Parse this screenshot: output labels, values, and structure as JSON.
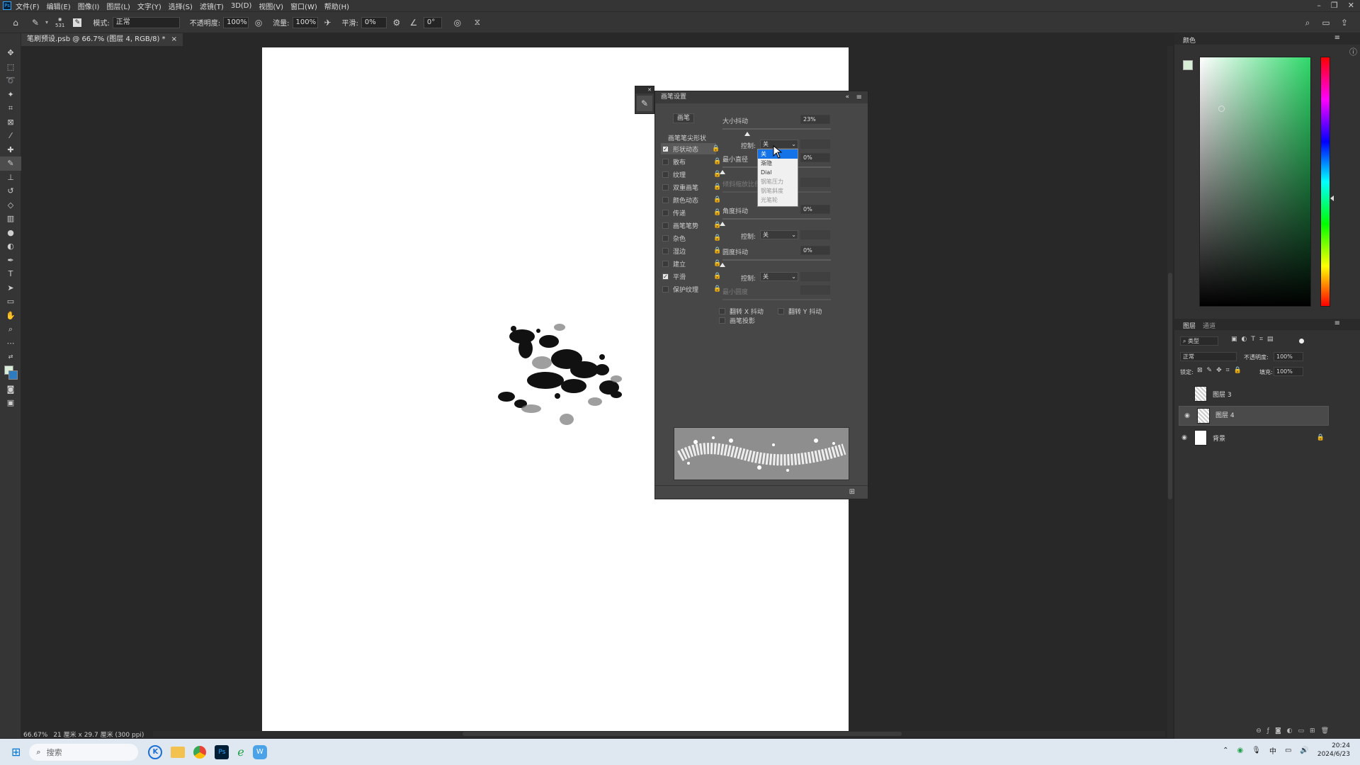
{
  "menu": {
    "items": [
      "文件(F)",
      "编辑(E)",
      "图像(I)",
      "图层(L)",
      "文字(Y)",
      "选择(S)",
      "滤镜(T)",
      "3D(D)",
      "视图(V)",
      "窗口(W)",
      "帮助(H)"
    ]
  },
  "options": {
    "brush_size": "531",
    "mode_label": "模式:",
    "mode_value": "正常",
    "opacity_label": "不透明度:",
    "opacity_value": "100%",
    "flow_label": "流量:",
    "flow_value": "100%",
    "smooth_label": "平滑:",
    "smooth_value": "0%",
    "angle_value": "0°"
  },
  "document": {
    "tab_title": "笔刷预设.psb @ 66.7% (图层 4, RGB/8) *",
    "close_glyph": "×"
  },
  "status": {
    "zoom": "66.67%",
    "size_info": "21 厘米 x 29.7 厘米 (300 ppi)"
  },
  "brush_panel": {
    "title": "画笔设置",
    "brushes_button": "画笔",
    "tip_shape": "画笔笔尖形状",
    "options": [
      {
        "label": "形状动态",
        "checked": true
      },
      {
        "label": "散布",
        "checked": false
      },
      {
        "label": "纹理",
        "checked": false
      },
      {
        "label": "双重画笔",
        "checked": false
      },
      {
        "label": "颜色动态",
        "checked": false
      },
      {
        "label": "传递",
        "checked": false
      },
      {
        "label": "画笔笔势",
        "checked": false
      },
      {
        "label": "杂色",
        "checked": false
      },
      {
        "label": "湿边",
        "checked": false
      },
      {
        "label": "建立",
        "checked": false
      },
      {
        "label": "平滑",
        "checked": true
      },
      {
        "label": "保护纹理",
        "checked": false
      }
    ],
    "size_jitter_label": "大小抖动",
    "size_jitter_value": "23%",
    "control_label": "控制:",
    "control_value": "关",
    "min_diameter_label": "最小直径",
    "min_diameter_value": "0%",
    "tilt_scale_label": "倾斜缩放比例",
    "angle_jitter_label": "角度抖动",
    "angle_jitter_value": "0%",
    "roundness_jitter_label": "圆度抖动",
    "roundness_jitter_value": "0%",
    "min_roundness_label": "最小圆度",
    "flip_x": "翻转 X 抖动",
    "flip_y": "翻转 Y 抖动",
    "brush_projection": "画笔投影",
    "size_jitter_level": 0.23,
    "dropdown": [
      "关",
      "渐隐",
      "Dial",
      "钢笔压力",
      "钢笔斜度",
      "光笔轮"
    ]
  },
  "right_panel": {
    "color_tab": "颜色",
    "layers_tab": "图层",
    "channels_tab": "通道",
    "kind_label": "类型",
    "blend_mode": "正常",
    "opacity_label": "不透明度:",
    "opacity_value": "100%",
    "lock_label": "锁定:",
    "fill_label": "填充:",
    "fill_value": "100%",
    "layers": [
      {
        "name": "图层 3",
        "visible": false,
        "selected": false
      },
      {
        "name": "图层 4",
        "visible": true,
        "selected": true
      },
      {
        "name": "背景",
        "visible": true,
        "selected": false
      }
    ]
  },
  "taskbar": {
    "search_placeholder": "搜索",
    "time": "20:24",
    "date": "2024/6/23",
    "ime": "中"
  },
  "colors": {
    "accent": "#1473e6",
    "ps_blue": "#31a8ff"
  }
}
